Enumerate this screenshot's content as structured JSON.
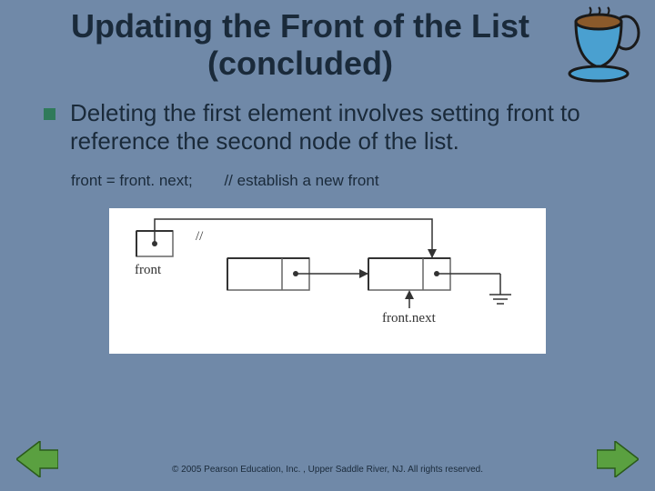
{
  "title": "Updating the Front of the List (concluded)",
  "bullet": "Deleting the first element involves setting front to reference the second node of the list.",
  "code": {
    "stmt": "front = front. next;",
    "comment": "// establish a new front"
  },
  "diagram": {
    "label_front": "front",
    "label_front_next": "front.next",
    "crossed": "//"
  },
  "footer": "© 2005 Pearson Education, Inc. , Upper Saddle River, NJ.  All rights reserved.",
  "icons": {
    "cup": "coffee-cup-icon",
    "prev": "nav-prev-arrow",
    "next": "nav-next-arrow"
  }
}
